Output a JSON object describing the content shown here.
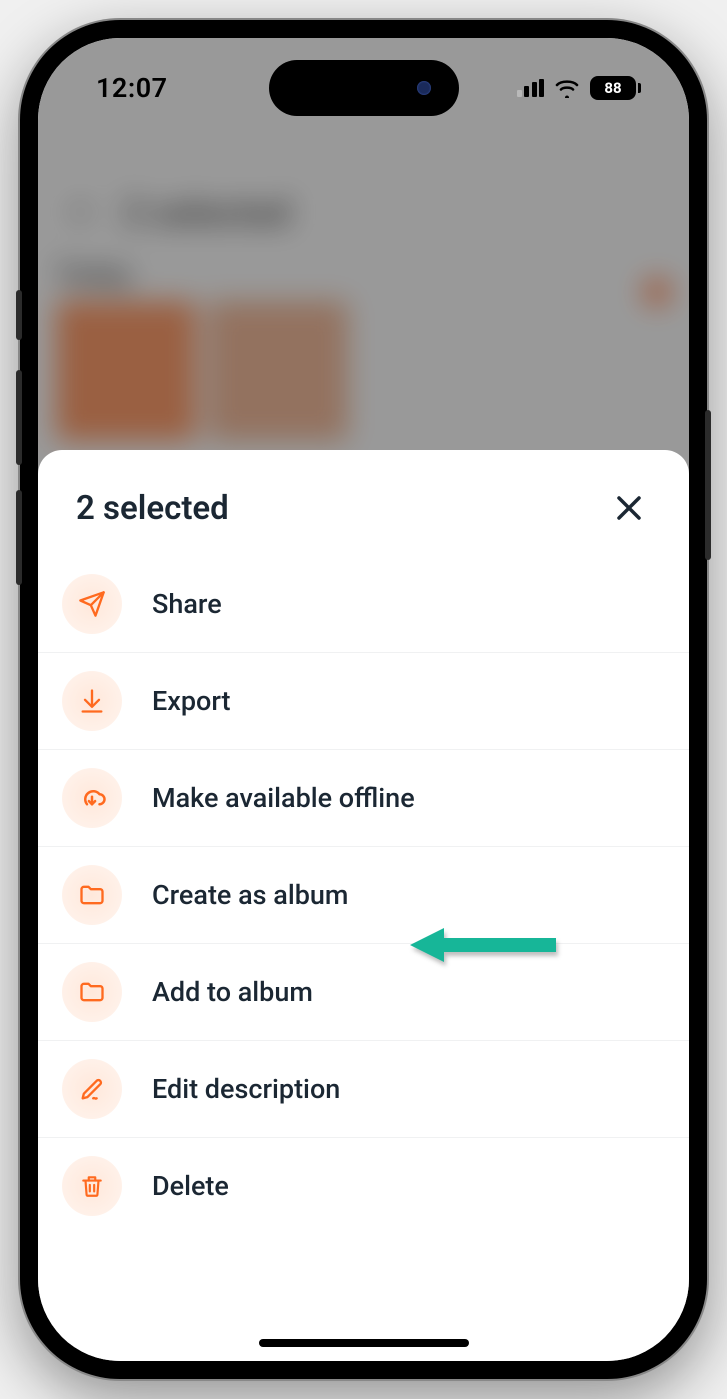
{
  "status": {
    "time": "12:07",
    "battery_percent": "88"
  },
  "sheet": {
    "title": "2 selected"
  },
  "menu": {
    "items": [
      {
        "label": "Share",
        "icon": "send-icon"
      },
      {
        "label": "Export",
        "icon": "download-icon"
      },
      {
        "label": "Make available offline",
        "icon": "cloud-download-icon"
      },
      {
        "label": "Create as album",
        "icon": "folder-icon"
      },
      {
        "label": "Add to album",
        "icon": "folder-icon"
      },
      {
        "label": "Edit description",
        "icon": "pencil-icon"
      },
      {
        "label": "Delete",
        "icon": "trash-icon"
      }
    ]
  },
  "annotation": {
    "arrow_points_to": "Create as album",
    "arrow_color": "#17b698"
  }
}
